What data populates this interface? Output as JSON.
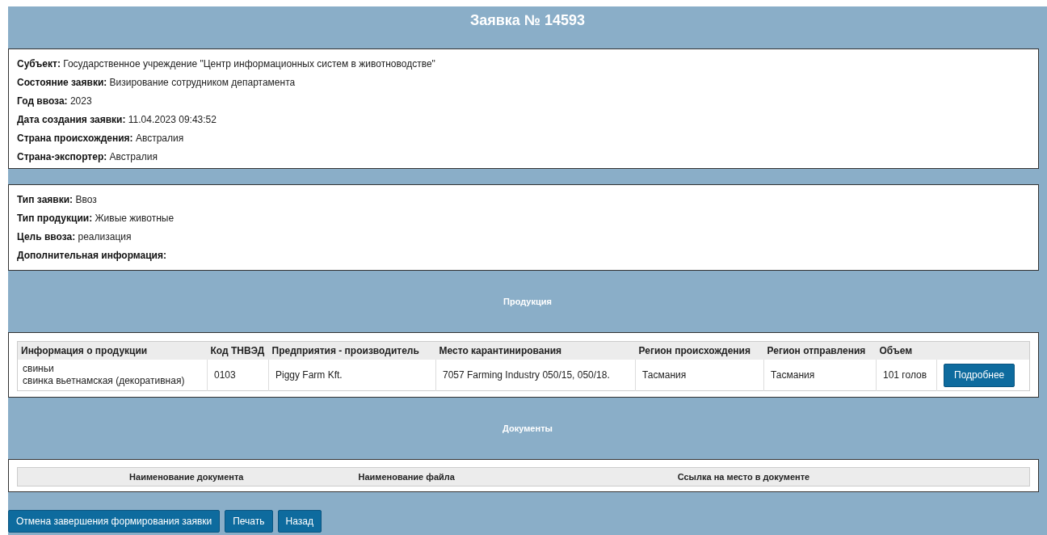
{
  "title": "Заявка № 14593",
  "general": [
    {
      "label": "Субъект:",
      "value": "Государственное учреждение \"Центр информационных систем в животноводстве\""
    },
    {
      "label": "Состояние заявки:",
      "value": "Визирование сотрудником департамента"
    },
    {
      "label": "Год ввоза:",
      "value": "2023"
    },
    {
      "label": "Дата создания заявки:",
      "value": "11.04.2023 09:43:52"
    },
    {
      "label": "Страна происхождения:",
      "value": "Австралия"
    },
    {
      "label": "Страна-экспортер:",
      "value": "Австралия"
    }
  ],
  "details": [
    {
      "label": "Тип заявки:",
      "value": "Ввоз"
    },
    {
      "label": "Тип продукции:",
      "value": "Живые животные"
    },
    {
      "label": "Цель ввоза:",
      "value": "реализация"
    },
    {
      "label": "Дополнительная информация:"
    }
  ],
  "products": {
    "heading": "Продукция",
    "columns": [
      "Информация о продукции",
      "Код ТНВЭД",
      "Предприятия - производитель",
      "Место карантинирования",
      "Регион происхождения",
      "Регион отправления",
      "Объем"
    ],
    "rows": [
      {
        "cells": [
          "свиньи\nсвинка вьетнамская (декоративная)",
          "0103",
          "Piggy Farm Kft.",
          "7057 Farming Industry 050/15, 050/18.",
          "Тасмания",
          "Тасмания",
          "101 голов"
        ],
        "button": "Подробнее"
      }
    ]
  },
  "documents": {
    "heading": "Документы",
    "columns": [
      "Наименование документа",
      "Наименование файла",
      "Ссылка на место в документе"
    ]
  },
  "buttons": [
    "Отмена завершения формирования заявки",
    "Печать",
    "Назад"
  ]
}
